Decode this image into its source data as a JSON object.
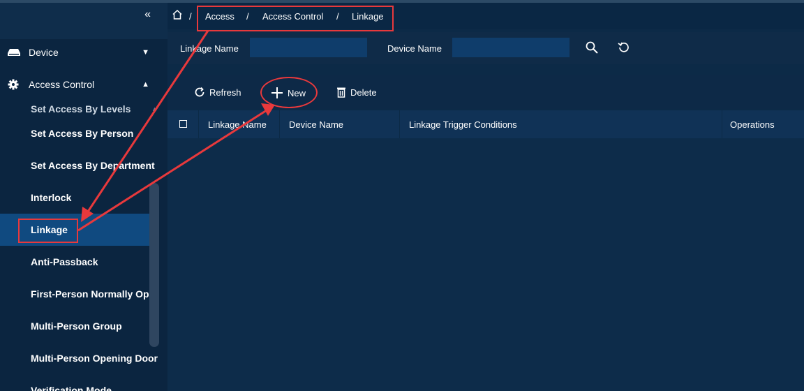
{
  "sidebar": {
    "collapse_icon": "double-chevron-left-icon",
    "groups": [
      {
        "label": "Device",
        "icon": "device-icon",
        "chevron": "chevron-down-icon"
      },
      {
        "label": "Access Control",
        "icon": "gear-icon",
        "chevron": "chevron-up-icon"
      }
    ],
    "items": [
      {
        "label": "Set Access By Levels"
      },
      {
        "label": "Set Access By Person"
      },
      {
        "label": "Set Access By Department"
      },
      {
        "label": "Interlock"
      },
      {
        "label": "Linkage"
      },
      {
        "label": "Anti-Passback"
      },
      {
        "label": "First-Person Normally Open"
      },
      {
        "label": "Multi-Person Group"
      },
      {
        "label": "Multi-Person Opening Door"
      },
      {
        "label": "Verification Mode"
      }
    ],
    "active_item": "Linkage"
  },
  "header": {
    "home_icon": "home-icon",
    "breadcrumb": [
      "Access",
      "Access Control",
      "Linkage"
    ],
    "separator": "/"
  },
  "filter": {
    "linkage_name_label": "Linkage Name",
    "device_name_label": "Device Name",
    "linkage_name_value": "",
    "device_name_value": "",
    "search_icon": "search-icon",
    "reset_icon": "reset-icon"
  },
  "toolbar": {
    "refresh_label": "Refresh",
    "new_label": "New",
    "delete_label": "Delete"
  },
  "table": {
    "columns": [
      "Linkage Name",
      "Device Name",
      "Linkage Trigger Conditions",
      "Operations"
    ],
    "rows": []
  },
  "colors": {
    "background": "#0c2a47",
    "sidebar": "#0b2540",
    "active_item": "#104a80",
    "input": "#0f3d6b",
    "annotation": "#e8393c"
  }
}
